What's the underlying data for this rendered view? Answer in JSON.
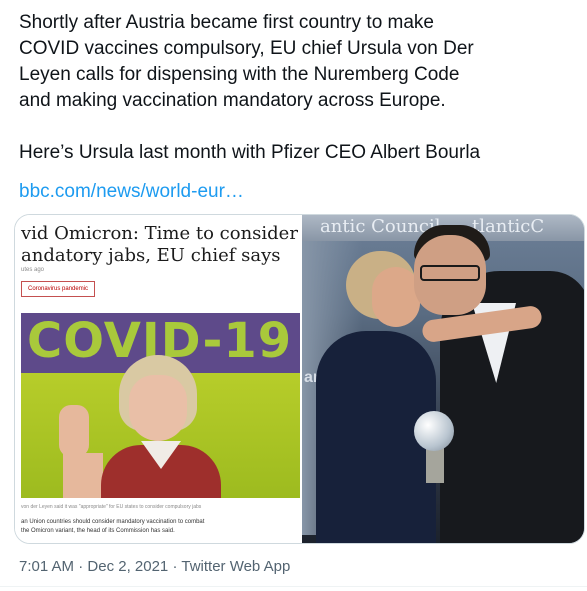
{
  "tweet": {
    "text_line1": "Shortly after Austria became first country to make",
    "text_line2": "COVID vaccines compulsory, EU chief Ursula von Der",
    "text_line3": "Leyen calls for dispensing with the Nuremberg Code",
    "text_line4": "and making vaccination mandatory across Europe.",
    "text_para2": "Here’s Ursula last month with Pfizer CEO Albert Bourla",
    "link": "bbc.com/news/world-eur…",
    "time": "7:01 AM",
    "separator": "·",
    "date": "Dec 2, 2021",
    "client": "Twitter Web App"
  },
  "media": {
    "article": {
      "headline_line1": "vid Omicron: Time to consider",
      "headline_line2": "andatory jabs, EU chief says",
      "time_ago": "utes ago",
      "tag": "Coronavirus pandemic",
      "photo_text": "COVID-19",
      "caption": "von der Leyen said it was \"appropriate\" for EU states to consider compulsory jabs",
      "body_line1": "an Union countries should consider mandatory vaccination to combat",
      "body_line2": "the Omicron variant, the head of its Commission has said."
    },
    "event": {
      "banner_left": "antic Council",
      "banner_right": "tlanticC",
      "side_text": "anti"
    }
  }
}
